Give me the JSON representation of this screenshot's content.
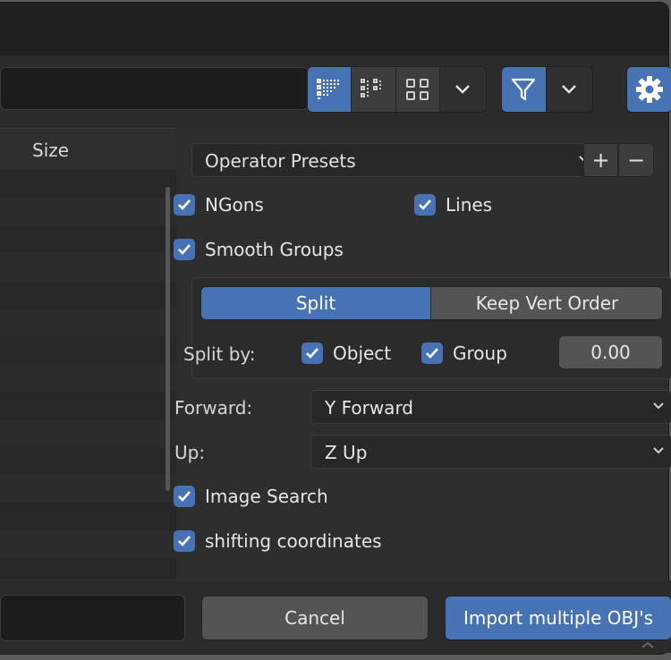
{
  "file_list": {
    "column_size": "Size"
  },
  "presets": {
    "label": "Operator Presets",
    "add": "+",
    "remove": "−"
  },
  "options": {
    "ngons": {
      "label": "NGons",
      "checked": true
    },
    "lines": {
      "label": "Lines",
      "checked": true
    },
    "smooth_groups": {
      "label": "Smooth Groups",
      "checked": true
    },
    "image_search": {
      "label": "Image Search",
      "checked": true
    },
    "shifting": {
      "label": "shifting coordinates",
      "checked": true
    }
  },
  "split": {
    "tabs": [
      "Split",
      "Keep Vert Order"
    ],
    "active_tab": "Split",
    "split_by_label": "Split by:",
    "object": {
      "label": "Object",
      "checked": true
    },
    "group": {
      "label": "Group",
      "checked": true
    },
    "value": "0.00"
  },
  "forward": {
    "label": "Forward:",
    "value": "Y Forward"
  },
  "up": {
    "label": "Up:",
    "value": "Z Up"
  },
  "buttons": {
    "cancel": "Cancel",
    "import": "Import multiple OBJ's"
  },
  "colors": {
    "accent": "#4772b3",
    "panel": "#2e2e2e",
    "field": "#282828"
  },
  "icons": [
    "vertical-list-icon",
    "horizontal-list-icon",
    "thumbnails-icon",
    "chevron-down-icon",
    "filter-icon",
    "gear-icon",
    "checkmark-icon"
  ]
}
